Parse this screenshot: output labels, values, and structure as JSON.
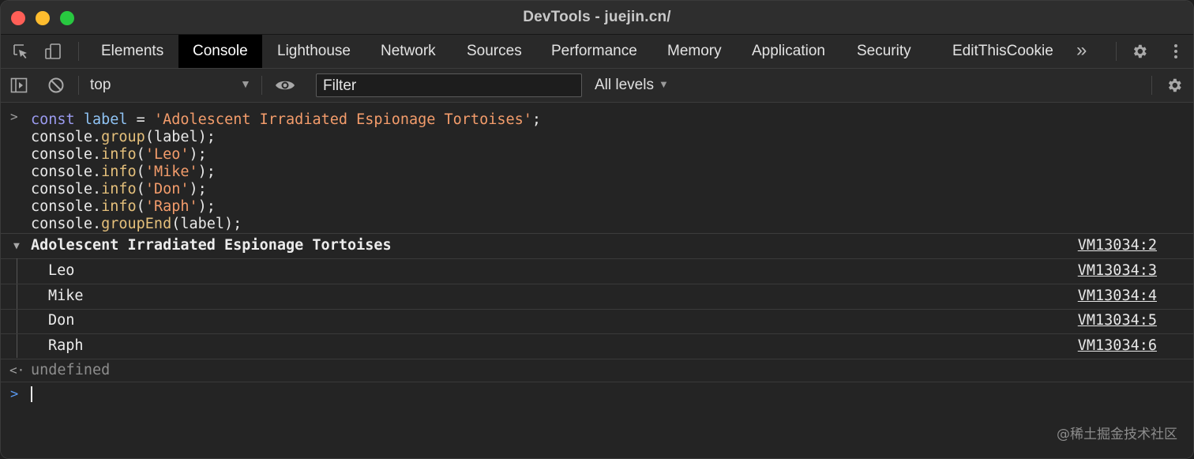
{
  "window": {
    "title": "DevTools - juejin.cn/"
  },
  "tabs": [
    {
      "label": "Elements"
    },
    {
      "label": "Console",
      "active": true
    },
    {
      "label": "Lighthouse"
    },
    {
      "label": "Network"
    },
    {
      "label": "Sources"
    },
    {
      "label": "Performance"
    },
    {
      "label": "Memory"
    },
    {
      "label": "Application"
    },
    {
      "label": "Security"
    },
    {
      "label": "EditThisCookie"
    }
  ],
  "tabbar_icons": [
    "inspect-element-icon",
    "device-toolbar-icon",
    "more-tabs-icon",
    "settings-icon",
    "kebab-menu-icon"
  ],
  "toolbar": {
    "context": "top",
    "filter_placeholder": "Filter",
    "levels": "All levels",
    "icons": [
      "sidebar-toggle-icon",
      "clear-console-icon",
      "live-expression-eye-icon",
      "console-settings-icon"
    ]
  },
  "console": {
    "code_lines": [
      [
        {
          "t": "const",
          "c": "kw"
        },
        {
          "t": " "
        },
        {
          "t": "label",
          "c": "var"
        },
        {
          "t": " = "
        },
        {
          "t": "'Adolescent Irradiated Espionage Tortoises'",
          "c": "str"
        },
        {
          "t": ";"
        }
      ],
      [
        {
          "t": "console."
        },
        {
          "t": "group",
          "c": "fn"
        },
        {
          "t": "(label);"
        }
      ],
      [
        {
          "t": "console."
        },
        {
          "t": "info",
          "c": "fn"
        },
        {
          "t": "("
        },
        {
          "t": "'Leo'",
          "c": "str"
        },
        {
          "t": ");"
        }
      ],
      [
        {
          "t": "console."
        },
        {
          "t": "info",
          "c": "fn"
        },
        {
          "t": "("
        },
        {
          "t": "'Mike'",
          "c": "str"
        },
        {
          "t": ");"
        }
      ],
      [
        {
          "t": "console."
        },
        {
          "t": "info",
          "c": "fn"
        },
        {
          "t": "("
        },
        {
          "t": "'Don'",
          "c": "str"
        },
        {
          "t": ");"
        }
      ],
      [
        {
          "t": "console."
        },
        {
          "t": "info",
          "c": "fn"
        },
        {
          "t": "("
        },
        {
          "t": "'Raph'",
          "c": "str"
        },
        {
          "t": ");"
        }
      ],
      [
        {
          "t": "console."
        },
        {
          "t": "groupEnd",
          "c": "fn"
        },
        {
          "t": "(label);"
        }
      ]
    ],
    "group": {
      "label": "Adolescent Irradiated Espionage Tortoises",
      "source": "VM13034:2"
    },
    "messages": [
      {
        "text": "Leo",
        "source": "VM13034:3"
      },
      {
        "text": "Mike",
        "source": "VM13034:4"
      },
      {
        "text": "Don",
        "source": "VM13034:5"
      },
      {
        "text": "Raph",
        "source": "VM13034:6"
      }
    ],
    "result": "undefined"
  },
  "watermark": "@稀土掘金技术社区",
  "colors": {
    "keyword": "#9b9bf0",
    "variable": "#8fc3f4",
    "string": "#f39c6b",
    "function": "#e5c07b",
    "prompt_blue": "#5b9bf3"
  }
}
